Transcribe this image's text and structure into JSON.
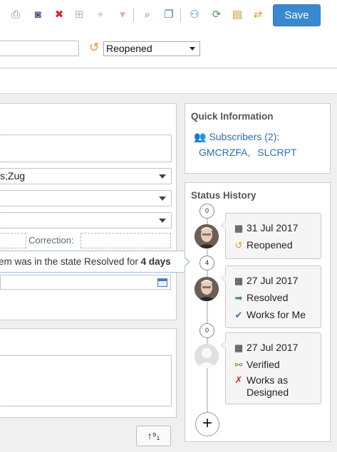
{
  "toolbar": {
    "icons": [
      {
        "name": "print-icon",
        "glyph": "⎙",
        "color": "#6b86b0"
      },
      {
        "name": "camera-icon",
        "glyph": "◙",
        "color": "#4f4f8a"
      },
      {
        "name": "delete-icon",
        "glyph": "✖",
        "color": "#d9262a"
      },
      {
        "name": "hierarchy-icon",
        "glyph": "⊞",
        "color": "#a9b8cc"
      },
      {
        "name": "btq-icon",
        "glyph": "⌖",
        "color": "#a9b8cc"
      },
      {
        "name": "gitlab-icon",
        "glyph": "▾",
        "color": "#e8a59a"
      },
      {
        "name": "document-search-icon",
        "glyph": "⌕",
        "color": "#4c76a6"
      },
      {
        "name": "copy-icon",
        "glyph": "❐",
        "color": "#4c76a6"
      },
      {
        "name": "link-items-icon",
        "glyph": "⚇",
        "color": "#2f80c9"
      },
      {
        "name": "import-icon",
        "glyph": "⟳",
        "color": "#4c9a52"
      },
      {
        "name": "clipboard-icon",
        "glyph": "▤",
        "color": "#c9962e"
      },
      {
        "name": "sync-icon",
        "glyph": "⇄",
        "color": "#d3a12a"
      }
    ],
    "save_label": "Save",
    "save_color": "#3a89d0"
  },
  "state": {
    "current": "Reopened"
  },
  "form": {
    "row2_value": "s;Zug",
    "correction_label": "Correction:",
    "tooltip_prefix": "em was in the state Resolved for ",
    "tooltip_bold": "4 days",
    "sort_label": "↑⁹₁"
  },
  "quick_info": {
    "title": "Quick Information",
    "subscribers_label": "Subscribers (2):",
    "subscriber_1": "GMCRZFA,",
    "subscriber_2": "SLCRPT"
  },
  "status_history": {
    "title": "Status History",
    "badges": [
      "0",
      "4",
      "0"
    ],
    "entries": [
      {
        "date": "31 Jul 2017",
        "state": "Reopened",
        "state_icon": "↺",
        "state_icon_color": "#e09a2a",
        "resolution": null
      },
      {
        "date": "27 Jul 2017",
        "state": "Resolved",
        "state_icon": "➡",
        "state_icon_color": "#3d9a45",
        "resolution": "Works for Me",
        "resolution_icon": "✔",
        "resolution_icon_color": "#3b6fb0"
      },
      {
        "date": "27 Jul 2017",
        "state": "Verified",
        "state_icon": "⚯",
        "state_icon_color": "#5a8f3a",
        "resolution": "Works as Designed",
        "resolution_line1": "Works as",
        "resolution_line2": "Designed",
        "resolution_icon": "✗",
        "resolution_icon_color": "#d42a2a"
      }
    ],
    "add_label": "+"
  }
}
